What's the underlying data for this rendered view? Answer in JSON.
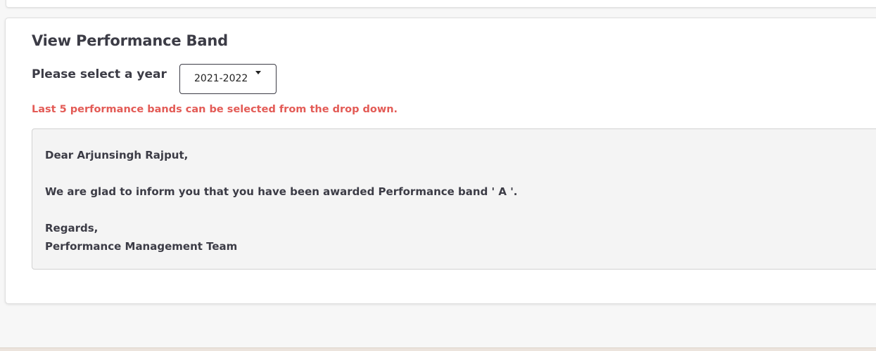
{
  "panel": {
    "title": "View Performance Band",
    "year_label": "Please select a year",
    "year_select": {
      "selected": "2021-2022"
    },
    "hint": "Last 5 performance bands can be selected from the drop down."
  },
  "message": {
    "greeting": "Dear Arjunsingh Rajput,",
    "body": "We are glad to inform you that you have been awarded Performance band ' A '.",
    "closing": "Regards,",
    "signature": "Performance Management Team"
  },
  "icons": {
    "dropdown": "caret-down-icon"
  },
  "colors": {
    "hint": "#e35b56",
    "text": "#3c3c46",
    "message_bg": "#f4f4f4"
  }
}
